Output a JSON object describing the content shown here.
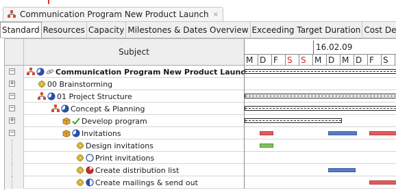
{
  "document": {
    "title": "Communication Program New Product Launch",
    "close": "×"
  },
  "view_tabs": [
    {
      "label": "Standard",
      "active": true
    },
    {
      "label": "Resources",
      "active": false
    },
    {
      "label": "Capacity",
      "active": false
    },
    {
      "label": "Milestones & Dates Overview",
      "active": false
    },
    {
      "label": "Exceeding Target Duration",
      "active": false
    },
    {
      "label": "Cost De",
      "active": false
    }
  ],
  "table": {
    "subject_header": "Subject",
    "week_label": "16.02.09",
    "days": [
      {
        "label": "M",
        "weekend": false
      },
      {
        "label": "D",
        "weekend": false
      },
      {
        "label": "F",
        "weekend": false
      },
      {
        "label": "S",
        "weekend": true
      },
      {
        "label": "S",
        "weekend": true
      },
      {
        "label": "M",
        "weekend": false
      },
      {
        "label": "D",
        "weekend": false
      },
      {
        "label": "M",
        "weekend": false
      },
      {
        "label": "D",
        "weekend": false
      },
      {
        "label": "F",
        "weekend": false
      },
      {
        "label": "S",
        "weekend": false
      }
    ],
    "rows": [
      {
        "label": "Communication Program New Product Launch",
        "bold": true,
        "expander": "−",
        "icons": [
          "org-chart-icon",
          "pie-progress-icon",
          "link-icon"
        ]
      },
      {
        "label": "00 Brainstorming",
        "bold": false,
        "expander": "+",
        "icons": [
          "gear-icon"
        ]
      },
      {
        "label": "01 Project Structure",
        "bold": false,
        "expander": "−",
        "icons": [
          "org-chart-icon",
          "pie-progress-icon"
        ]
      },
      {
        "label": "Concept & Planning",
        "bold": false,
        "expander": "−",
        "icons": [
          "org-chart-icon",
          "pie-progress-icon"
        ]
      },
      {
        "label": "Develop program",
        "bold": false,
        "expander": "+",
        "icons": [
          "package-icon",
          "checkmark-icon"
        ]
      },
      {
        "label": "Invitations",
        "bold": false,
        "expander": "−",
        "icons": [
          "package-icon",
          "pie-progress-icon"
        ]
      },
      {
        "label": "Design invitations",
        "bold": false,
        "expander": "",
        "icons": [
          "gear-icon"
        ]
      },
      {
        "label": "Print invitations",
        "bold": false,
        "expander": "",
        "icons": [
          "gear-icon",
          "empty-circle-icon"
        ]
      },
      {
        "label": "Create distribution list",
        "bold": false,
        "expander": "",
        "icons": [
          "gear-icon",
          "red-pie-icon"
        ]
      },
      {
        "label": "Create mailings & send out",
        "bold": false,
        "expander": "",
        "icons": [
          "gear-icon",
          "half-pie-icon"
        ]
      }
    ]
  },
  "colors": {
    "summary": "#222222",
    "task_red": "#e35d5d",
    "task_blue": "#5a7ac2",
    "task_green": "#82c45c",
    "weekend_text": "#e02020"
  }
}
